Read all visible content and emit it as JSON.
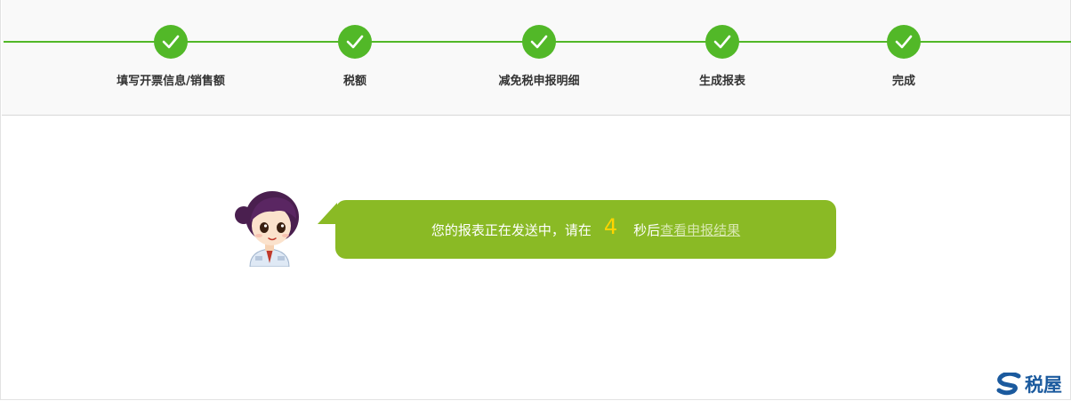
{
  "steps": [
    {
      "label": "填写开票信息/销售额",
      "icon": "check-icon"
    },
    {
      "label": "税额",
      "icon": "check-icon"
    },
    {
      "label": "减免税申报明细",
      "icon": "check-icon"
    },
    {
      "label": "生成报表",
      "icon": "check-icon"
    },
    {
      "label": "完成",
      "icon": "check-icon"
    }
  ],
  "message": {
    "before": "您的报表正在发送中，请在",
    "countdown": "4",
    "after": "秒后",
    "link": "查看申报结果"
  },
  "brand": {
    "name": "税屋"
  },
  "colors": {
    "step_green": "#52b828",
    "bubble_green": "#8aba25",
    "countdown_yellow": "#ffd400",
    "brand_blue": "#1b5a9e"
  }
}
